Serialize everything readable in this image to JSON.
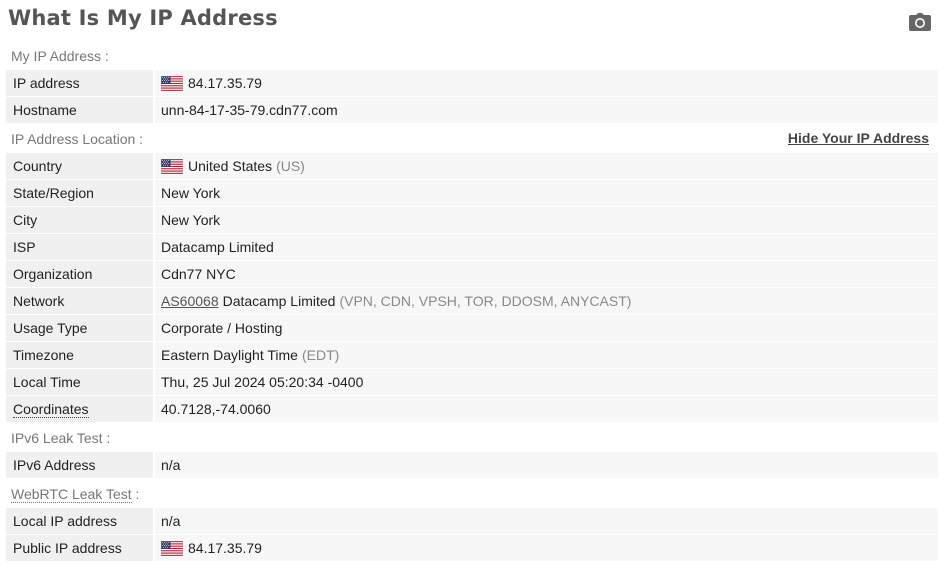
{
  "page": {
    "title": "What Is My IP Address",
    "camera_icon": "camera-icon"
  },
  "my_ip": {
    "section_label": "My IP Address :",
    "rows": [
      {
        "label": "IP address",
        "value": "84.17.35.79",
        "flag": "us-flag-icon"
      },
      {
        "label": "Hostname",
        "value": "unn-84-17-35-79.cdn77.com"
      }
    ]
  },
  "location": {
    "section_label": "IP Address Location :",
    "hide_link": "Hide Your IP Address",
    "country": {
      "label": "Country",
      "value": "United States",
      "code": "(US)",
      "flag": "us-flag-icon"
    },
    "state": {
      "label": "State/Region",
      "value": "New York"
    },
    "city": {
      "label": "City",
      "value": "New York"
    },
    "isp": {
      "label": "ISP",
      "value": "Datacamp Limited"
    },
    "organization": {
      "label": "Organization",
      "value": "Cdn77 NYC"
    },
    "network": {
      "label": "Network",
      "asn": "AS60068",
      "name": "Datacamp Limited",
      "tags": "(VPN, CDN, VPSH, TOR, DDOSM, ANYCAST)"
    },
    "usage": {
      "label": "Usage Type",
      "value": "Corporate / Hosting"
    },
    "timezone": {
      "label": "Timezone",
      "value": "Eastern Daylight Time",
      "abbr": "(EDT)"
    },
    "local_time": {
      "label": "Local Time",
      "value": "Thu, 25 Jul 2024 05:20:34 -0400"
    },
    "coordinates": {
      "label": "Coordinates",
      "value": "40.7128,-74.0060"
    }
  },
  "ipv6": {
    "section_label": "IPv6 Leak Test :",
    "address": {
      "label": "IPv6 Address",
      "value": "n/a"
    }
  },
  "webrtc": {
    "section_label_main": "WebRTC Leak Test",
    "section_label_suffix": " :",
    "local": {
      "label": "Local IP address",
      "value": "n/a"
    },
    "public": {
      "label": "Public IP address",
      "value": "84.17.35.79",
      "flag": "us-flag-icon"
    }
  },
  "colors": {
    "label_bg": "#f0f0f0",
    "value_bg": "#f7f7f7",
    "title": "#555555"
  }
}
